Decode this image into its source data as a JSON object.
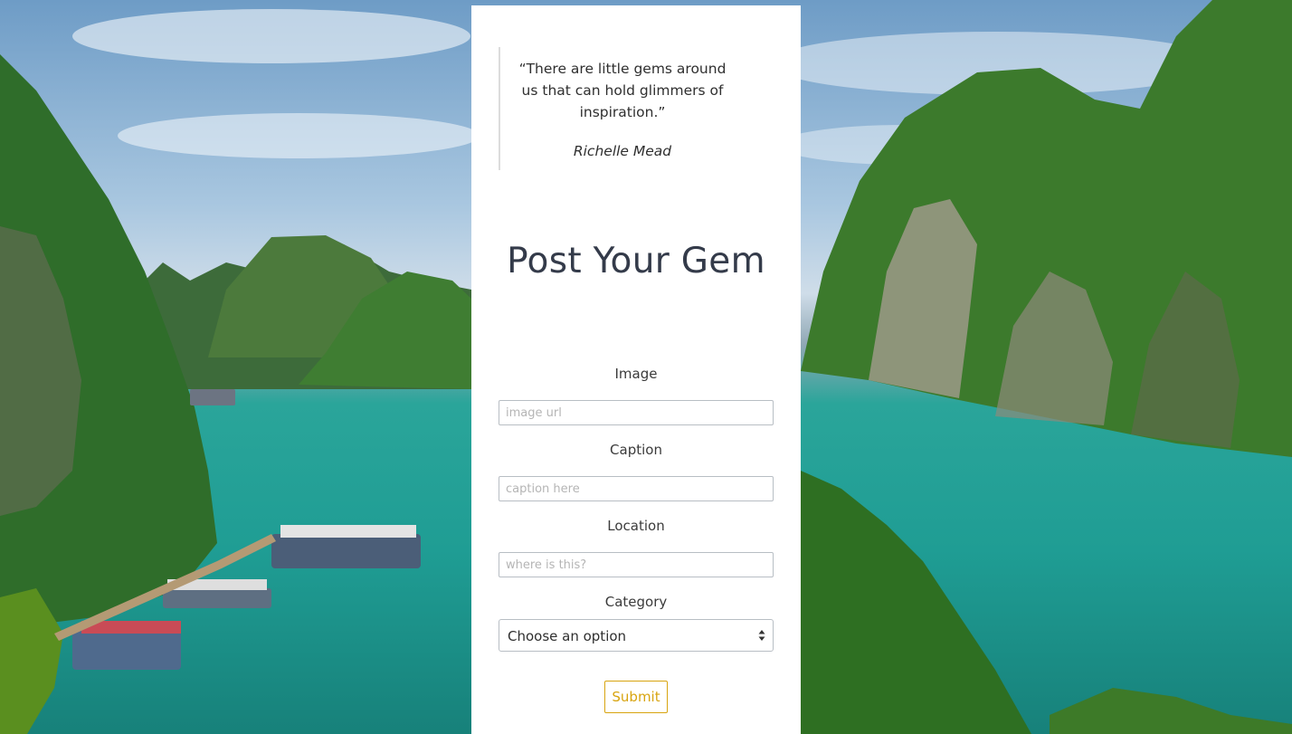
{
  "quote": {
    "text": "“There are little gems around us that can hold glimmers of inspiration.”",
    "author": "Richelle Mead"
  },
  "page": {
    "title": "Post Your Gem"
  },
  "form": {
    "image_label": "Image",
    "image_placeholder": "image url",
    "caption_label": "Caption",
    "caption_placeholder": "caption here",
    "location_label": "Location",
    "location_placeholder": "where is this?",
    "category_label": "Category",
    "category_selected": "Choose an option",
    "submit_label": "Submit"
  },
  "colors": {
    "accent": "#d8a40f",
    "title": "#343b4a",
    "panel": "#ffffff"
  }
}
